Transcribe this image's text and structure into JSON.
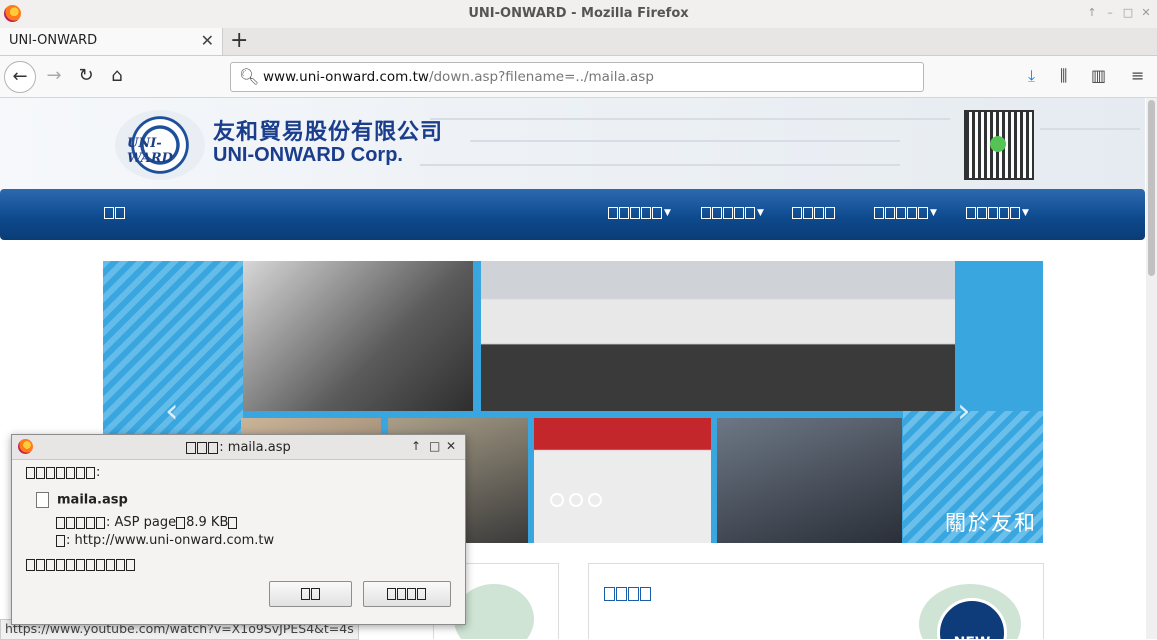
{
  "window": {
    "title": "UNI-ONWARD - Mozilla Firefox"
  },
  "tabs": [
    {
      "label": "UNI-ONWARD"
    }
  ],
  "urlbar": {
    "domain": "www.uni-onward.com.tw",
    "path": "/down.asp?filename=../maila.asp"
  },
  "site": {
    "logo_cn": "友和貿易股份有限公司",
    "logo_en": "UNI-ONWARD Corp.",
    "logo_mark_text": "UNI-WARD",
    "banner_caption": "關於友和",
    "new_badge": "NEW"
  },
  "download_dialog": {
    "title_suffix": ": maila.asp",
    "file_name": "maila.asp",
    "type_value": ": ASP page",
    "size_value": "8.9 KB",
    "source_value": ": http://www.uni-onward.com.tw"
  },
  "statusbar": {
    "text": "https://www.youtube.com/watch?v=X1o9SvJPES4&t=4s"
  },
  "colors": {
    "nav_blue": "#0e4a8e",
    "banner_blue": "#3aa6df",
    "logo_blue": "#1a3d8c"
  }
}
